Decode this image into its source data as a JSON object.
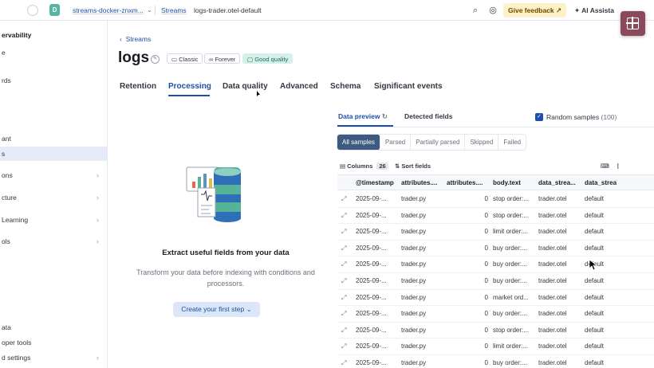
{
  "header": {
    "breadcrumbs": [
      "streams-docker-znxm...",
      "Streams",
      "logs-trader.otel-default"
    ],
    "feedback_label": "Give feedback",
    "ai_label": "AI Assista"
  },
  "sidebar": {
    "items": [
      {
        "label": "ervability",
        "kind": "title"
      },
      {
        "label": "e",
        "kind": "item"
      },
      {
        "label": "rds",
        "kind": "item"
      },
      {
        "label": "ant",
        "kind": "item"
      },
      {
        "label": "s",
        "kind": "active"
      },
      {
        "label": "ons",
        "kind": "chevron"
      },
      {
        "label": "cture",
        "kind": "chevron"
      },
      {
        "label": "Learning",
        "kind": "chevron"
      },
      {
        "label": "ols",
        "kind": "chevron"
      },
      {
        "label": "ata",
        "kind": "item"
      },
      {
        "label": "oper tools",
        "kind": "item"
      },
      {
        "label": "d settings",
        "kind": "chevron"
      }
    ]
  },
  "page": {
    "back_label": "Streams",
    "title": "logs",
    "badges": [
      "Classic",
      "Forever",
      "Good quality"
    ],
    "tabs": [
      "Retention",
      "Processing",
      "Data quality",
      "Advanced",
      "Schema",
      "Significant events"
    ]
  },
  "empty_state": {
    "title": "Extract useful fields from your data",
    "description": "Transform your data before indexing with conditions and processors.",
    "button_label": "Create your first step"
  },
  "preview": {
    "tabs": [
      "Data preview",
      "Detected fields"
    ],
    "random_samples_label": "Random samples",
    "random_samples_count": "(100)",
    "filters": [
      "All samples",
      "Parsed",
      "Partially parsed",
      "Skipped",
      "Failed"
    ],
    "columns_label": "Columns",
    "columns_count": "26",
    "sort_label": "Sort fields",
    "headers": [
      "@timestamp",
      "attributes....",
      "attributes....",
      "body.text",
      "data_strea...",
      "data_strea"
    ],
    "rows": [
      [
        "2025-09-...",
        "trader.py",
        "0",
        "stop order:...",
        "trader.otel",
        "default"
      ],
      [
        "2025-09-...",
        "trader.py",
        "0",
        "stop order:...",
        "trader.otel",
        "default"
      ],
      [
        "2025-09-...",
        "trader.py",
        "0",
        "limit order:...",
        "trader.otel",
        "default"
      ],
      [
        "2025-09-...",
        "trader.py",
        "0",
        "buy order:...",
        "trader.otel",
        "default"
      ],
      [
        "2025-09-...",
        "trader.py",
        "0",
        "buy order:...",
        "trader.otel",
        "default"
      ],
      [
        "2025-09-...",
        "trader.py",
        "0",
        "buy order:...",
        "trader.otel",
        "default"
      ],
      [
        "2025-09-...",
        "trader.py",
        "0",
        "market ord...",
        "trader.otel",
        "default"
      ],
      [
        "2025-09-...",
        "trader.py",
        "0",
        "buy order:...",
        "trader.otel",
        "default"
      ],
      [
        "2025-09-...",
        "trader.py",
        "0",
        "stop order:...",
        "trader.otel",
        "default"
      ],
      [
        "2025-09-...",
        "trader.py",
        "0",
        "limit order:...",
        "trader.otel",
        "default"
      ],
      [
        "2025-09-...",
        "trader.py",
        "0",
        "buy order:...",
        "trader.otel",
        "default"
      ]
    ]
  },
  "colors": {
    "accent": "#1d4fa8",
    "active_filter": "#3d5a80",
    "feedback_bg": "#fcf1c7",
    "good_quality_bg": "#d6f0e9",
    "collapse_button": "#8a4a5b"
  }
}
